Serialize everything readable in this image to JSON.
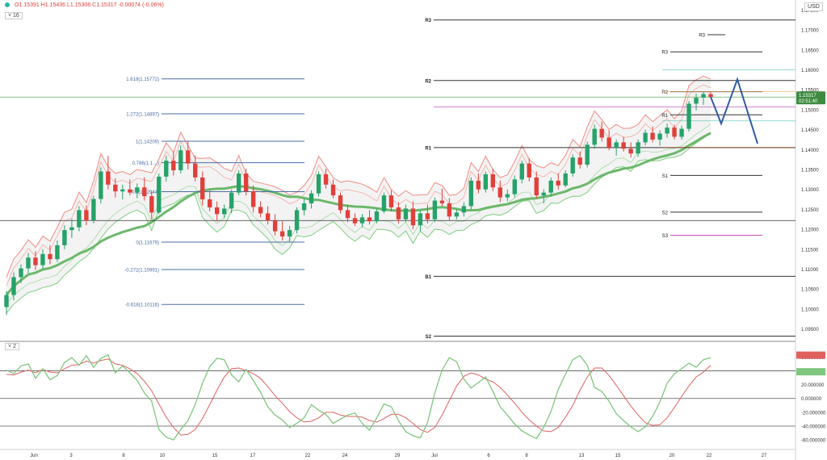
{
  "header": {
    "ohlc": "O1.15391  H1.15436  L1.15308  C1.15317  -0.00074 (-0.06%)",
    "indicator_collapse": "˅ 16",
    "osc_collapse": "˅ 2",
    "currency": "USD"
  },
  "colors": {
    "up": "#26a269",
    "down": "#e0403a",
    "envelope_red": "#f28b82",
    "envelope_green": "#7fcf7f",
    "ma": "#6cb86c",
    "ma_red": "#e57373",
    "fib": "#4a6fa5",
    "pivot": "#333333",
    "projection": "#2f5d9e",
    "stoch_k": "#7fc77f",
    "stoch_d": "#e06060",
    "price_tag": "#3d8b40"
  },
  "chart_data": {
    "type": "candlestick",
    "price_axis": {
      "ylim": [
        1.0925,
        1.1775
      ],
      "ticks": [
        "1.17500",
        "1.17000",
        "1.16500",
        "1.16000",
        "1.15500",
        "1.15000",
        "1.14500",
        "1.14000",
        "1.13500",
        "1.13000",
        "1.12500",
        "1.12000",
        "1.11500",
        "1.11000",
        "1.10500",
        "1.10000",
        "1.09500"
      ]
    },
    "x_axis": {
      "labels": [
        "Jun",
        "3",
        "8",
        "10",
        "15",
        "17",
        "22",
        "24",
        "29",
        "Jul",
        "6",
        "8",
        "13",
        "15",
        "20",
        "22",
        "27"
      ]
    },
    "fib_levels": [
      {
        "label": "1.618(1.15772)",
        "value": 1.15772
      },
      {
        "label": "1.272(1.14897)",
        "value": 1.14897
      },
      {
        "label": "1(1.14209)",
        "value": 1.14209
      },
      {
        "label": "0.786(1.1…)",
        "value": 1.1367
      },
      {
        "label": "0.5(1.12944)",
        "value": 1.12944
      },
      {
        "label": "0(1.11679)",
        "value": 1.11679
      },
      {
        "label": "-0.272(1.10991)",
        "value": 1.10991
      },
      {
        "label": "-0.618(1.10116)",
        "value": 1.10116
      }
    ],
    "monthly_pivots": [
      {
        "label": "R3",
        "value": 1.1725
      },
      {
        "label": "R2",
        "value": 1.1573
      },
      {
        "label": "R1",
        "value": 1.1405
      },
      {
        "label": "B1",
        "value": 1.1082
      },
      {
        "label": "S2",
        "value": 1.0932
      }
    ],
    "weekly_pivots": [
      {
        "label": "R3",
        "value": 1.1688
      },
      {
        "label": "R3",
        "value": 1.1645
      },
      {
        "label": "R2",
        "value": 1.1545
      },
      {
        "label": "R1",
        "value": 1.1487
      },
      {
        "label": "S1",
        "value": 1.1335
      },
      {
        "label": "S2",
        "value": 1.1243
      },
      {
        "label": "S3",
        "value": 1.1185
      }
    ],
    "candles": [
      {
        "o": 1.1005,
        "h": 1.1045,
        "l": 1.0985,
        "c": 1.1035
      },
      {
        "o": 1.1035,
        "h": 1.1092,
        "l": 1.1022,
        "c": 1.108
      },
      {
        "o": 1.108,
        "h": 1.1112,
        "l": 1.1065,
        "c": 1.1102
      },
      {
        "o": 1.1102,
        "h": 1.1141,
        "l": 1.109,
        "c": 1.1129
      },
      {
        "o": 1.1129,
        "h": 1.1145,
        "l": 1.1098,
        "c": 1.111
      },
      {
        "o": 1.111,
        "h": 1.115,
        "l": 1.11,
        "c": 1.1138
      },
      {
        "o": 1.1138,
        "h": 1.116,
        "l": 1.1112,
        "c": 1.1125
      },
      {
        "o": 1.1125,
        "h": 1.1172,
        "l": 1.1118,
        "c": 1.116
      },
      {
        "o": 1.116,
        "h": 1.121,
        "l": 1.115,
        "c": 1.1198
      },
      {
        "o": 1.1198,
        "h": 1.1226,
        "l": 1.1178,
        "c": 1.1205
      },
      {
        "o": 1.1205,
        "h": 1.1258,
        "l": 1.1195,
        "c": 1.1248
      },
      {
        "o": 1.1248,
        "h": 1.126,
        "l": 1.121,
        "c": 1.1222
      },
      {
        "o": 1.1222,
        "h": 1.1284,
        "l": 1.1215,
        "c": 1.1276
      },
      {
        "o": 1.1276,
        "h": 1.1355,
        "l": 1.1265,
        "c": 1.1345
      },
      {
        "o": 1.1345,
        "h": 1.1384,
        "l": 1.13,
        "c": 1.1312
      },
      {
        "o": 1.1312,
        "h": 1.1328,
        "l": 1.128,
        "c": 1.1295
      },
      {
        "o": 1.1295,
        "h": 1.1312,
        "l": 1.1275,
        "c": 1.13
      },
      {
        "o": 1.13,
        "h": 1.1325,
        "l": 1.1285,
        "c": 1.1292
      },
      {
        "o": 1.1292,
        "h": 1.1315,
        "l": 1.1278,
        "c": 1.1305
      },
      {
        "o": 1.1305,
        "h": 1.133,
        "l": 1.1272,
        "c": 1.1283
      },
      {
        "o": 1.1283,
        "h": 1.1295,
        "l": 1.1225,
        "c": 1.1242
      },
      {
        "o": 1.1242,
        "h": 1.134,
        "l": 1.1238,
        "c": 1.1332
      },
      {
        "o": 1.1332,
        "h": 1.1385,
        "l": 1.132,
        "c": 1.1372
      },
      {
        "o": 1.1372,
        "h": 1.1395,
        "l": 1.1335,
        "c": 1.1348
      },
      {
        "o": 1.1348,
        "h": 1.141,
        "l": 1.134,
        "c": 1.1398
      },
      {
        "o": 1.1398,
        "h": 1.1422,
        "l": 1.135,
        "c": 1.1365
      },
      {
        "o": 1.1365,
        "h": 1.1385,
        "l": 1.132,
        "c": 1.133
      },
      {
        "o": 1.133,
        "h": 1.1345,
        "l": 1.126,
        "c": 1.1275
      },
      {
        "o": 1.1275,
        "h": 1.1298,
        "l": 1.1245,
        "c": 1.1255
      },
      {
        "o": 1.1255,
        "h": 1.127,
        "l": 1.122,
        "c": 1.1238
      },
      {
        "o": 1.1238,
        "h": 1.1262,
        "l": 1.1228,
        "c": 1.1252
      },
      {
        "o": 1.1252,
        "h": 1.13,
        "l": 1.124,
        "c": 1.1292
      },
      {
        "o": 1.1292,
        "h": 1.1348,
        "l": 1.1285,
        "c": 1.134
      },
      {
        "o": 1.134,
        "h": 1.1352,
        "l": 1.1285,
        "c": 1.1295
      },
      {
        "o": 1.1295,
        "h": 1.131,
        "l": 1.1242,
        "c": 1.1256
      },
      {
        "o": 1.1256,
        "h": 1.127,
        "l": 1.123,
        "c": 1.124
      },
      {
        "o": 1.124,
        "h": 1.1258,
        "l": 1.1212,
        "c": 1.1222
      },
      {
        "o": 1.1222,
        "h": 1.1238,
        "l": 1.1185,
        "c": 1.1195
      },
      {
        "o": 1.1195,
        "h": 1.122,
        "l": 1.1172,
        "c": 1.1182
      },
      {
        "o": 1.1182,
        "h": 1.1208,
        "l": 1.1168,
        "c": 1.1198
      },
      {
        "o": 1.1198,
        "h": 1.1255,
        "l": 1.119,
        "c": 1.1248
      },
      {
        "o": 1.1248,
        "h": 1.1278,
        "l": 1.1235,
        "c": 1.1265
      },
      {
        "o": 1.1265,
        "h": 1.1298,
        "l": 1.1252,
        "c": 1.129
      },
      {
        "o": 1.129,
        "h": 1.1345,
        "l": 1.1282,
        "c": 1.1338
      },
      {
        "o": 1.1338,
        "h": 1.1352,
        "l": 1.1302,
        "c": 1.1312
      },
      {
        "o": 1.1312,
        "h": 1.1325,
        "l": 1.1278,
        "c": 1.1285
      },
      {
        "o": 1.1285,
        "h": 1.1292,
        "l": 1.124,
        "c": 1.1248
      },
      {
        "o": 1.1248,
        "h": 1.1262,
        "l": 1.1218,
        "c": 1.1228
      },
      {
        "o": 1.1228,
        "h": 1.124,
        "l": 1.1208,
        "c": 1.1215
      },
      {
        "o": 1.1215,
        "h": 1.1238,
        "l": 1.1205,
        "c": 1.123
      },
      {
        "o": 1.123,
        "h": 1.1248,
        "l": 1.1212,
        "c": 1.122
      },
      {
        "o": 1.122,
        "h": 1.1252,
        "l": 1.1215,
        "c": 1.1245
      },
      {
        "o": 1.1245,
        "h": 1.1292,
        "l": 1.124,
        "c": 1.1285
      },
      {
        "o": 1.1285,
        "h": 1.1298,
        "l": 1.1245,
        "c": 1.1255
      },
      {
        "o": 1.1255,
        "h": 1.1268,
        "l": 1.1215,
        "c": 1.1225
      },
      {
        "o": 1.1225,
        "h": 1.1262,
        "l": 1.1218,
        "c": 1.1252
      },
      {
        "o": 1.1252,
        "h": 1.127,
        "l": 1.12,
        "c": 1.121
      },
      {
        "o": 1.121,
        "h": 1.1248,
        "l": 1.1195,
        "c": 1.124
      },
      {
        "o": 1.124,
        "h": 1.1262,
        "l": 1.1215,
        "c": 1.1225
      },
      {
        "o": 1.1225,
        "h": 1.128,
        "l": 1.1218,
        "c": 1.1272
      },
      {
        "o": 1.1272,
        "h": 1.1302,
        "l": 1.1258,
        "c": 1.1265
      },
      {
        "o": 1.1265,
        "h": 1.1278,
        "l": 1.1222,
        "c": 1.1232
      },
      {
        "o": 1.1232,
        "h": 1.125,
        "l": 1.1225,
        "c": 1.1242
      },
      {
        "o": 1.1242,
        "h": 1.1268,
        "l": 1.1232,
        "c": 1.1258
      },
      {
        "o": 1.1258,
        "h": 1.133,
        "l": 1.125,
        "c": 1.1322
      },
      {
        "o": 1.1322,
        "h": 1.134,
        "l": 1.129,
        "c": 1.13
      },
      {
        "o": 1.13,
        "h": 1.1345,
        "l": 1.1292,
        "c": 1.1338
      },
      {
        "o": 1.1338,
        "h": 1.1352,
        "l": 1.1295,
        "c": 1.1305
      },
      {
        "o": 1.1305,
        "h": 1.1322,
        "l": 1.1268,
        "c": 1.128
      },
      {
        "o": 1.128,
        "h": 1.13,
        "l": 1.127,
        "c": 1.1288
      },
      {
        "o": 1.1288,
        "h": 1.1335,
        "l": 1.128,
        "c": 1.1325
      },
      {
        "o": 1.1325,
        "h": 1.1372,
        "l": 1.1315,
        "c": 1.1365
      },
      {
        "o": 1.1365,
        "h": 1.1378,
        "l": 1.132,
        "c": 1.133
      },
      {
        "o": 1.133,
        "h": 1.1345,
        "l": 1.1278,
        "c": 1.1285
      },
      {
        "o": 1.1285,
        "h": 1.13,
        "l": 1.1265,
        "c": 1.1292
      },
      {
        "o": 1.1292,
        "h": 1.133,
        "l": 1.1282,
        "c": 1.1322
      },
      {
        "o": 1.1322,
        "h": 1.134,
        "l": 1.13,
        "c": 1.131
      },
      {
        "o": 1.131,
        "h": 1.1348,
        "l": 1.1305,
        "c": 1.134
      },
      {
        "o": 1.134,
        "h": 1.1388,
        "l": 1.1332,
        "c": 1.138
      },
      {
        "o": 1.138,
        "h": 1.1395,
        "l": 1.1352,
        "c": 1.1362
      },
      {
        "o": 1.1362,
        "h": 1.142,
        "l": 1.1355,
        "c": 1.1412
      },
      {
        "o": 1.1412,
        "h": 1.1462,
        "l": 1.1402,
        "c": 1.1452
      },
      {
        "o": 1.1452,
        "h": 1.147,
        "l": 1.142,
        "c": 1.143
      },
      {
        "o": 1.143,
        "h": 1.1448,
        "l": 1.1398,
        "c": 1.1405
      },
      {
        "o": 1.1405,
        "h": 1.1425,
        "l": 1.1385,
        "c": 1.1418
      },
      {
        "o": 1.1418,
        "h": 1.1432,
        "l": 1.1395,
        "c": 1.1402
      },
      {
        "o": 1.1402,
        "h": 1.1418,
        "l": 1.138,
        "c": 1.139
      },
      {
        "o": 1.139,
        "h": 1.1425,
        "l": 1.1382,
        "c": 1.1418
      },
      {
        "o": 1.1418,
        "h": 1.145,
        "l": 1.141,
        "c": 1.1442
      },
      {
        "o": 1.1442,
        "h": 1.1458,
        "l": 1.1418,
        "c": 1.1425
      },
      {
        "o": 1.1425,
        "h": 1.1448,
        "l": 1.141,
        "c": 1.144
      },
      {
        "o": 1.144,
        "h": 1.1465,
        "l": 1.143,
        "c": 1.1455
      },
      {
        "o": 1.1455,
        "h": 1.1462,
        "l": 1.1425,
        "c": 1.1432
      },
      {
        "o": 1.1432,
        "h": 1.146,
        "l": 1.1425,
        "c": 1.1452
      },
      {
        "o": 1.1452,
        "h": 1.1522,
        "l": 1.1445,
        "c": 1.1515
      },
      {
        "o": 1.1515,
        "h": 1.154,
        "l": 1.1498,
        "c": 1.153
      },
      {
        "o": 1.153,
        "h": 1.1545,
        "l": 1.1512,
        "c": 1.1539
      },
      {
        "o": 1.1539,
        "h": 1.1544,
        "l": 1.1531,
        "c": 1.1532
      }
    ],
    "projection_path": [
      1.1532,
      1.1465,
      1.1576,
      1.1415
    ],
    "current_price_label": "1.15317",
    "countdown_label": "02:51:40",
    "oscillator": {
      "ylim": [
        -68,
        72
      ],
      "ticks": [
        "60.000000",
        "40.000000",
        "20.000000",
        "0.000000",
        "-20.000000",
        "-40.000000",
        "-60.000000"
      ],
      "levels": [
        40,
        0,
        -40
      ],
      "k": [
        41,
        36,
        47,
        50,
        29,
        43,
        27,
        33,
        52,
        59,
        48,
        62,
        45,
        58,
        63,
        37,
        47,
        37,
        26,
        8,
        -4,
        -45,
        -56,
        -60,
        -45,
        -32,
        -9,
        22,
        46,
        58,
        56,
        34,
        24,
        42,
        26,
        9,
        -12,
        -24,
        -31,
        -42,
        -36,
        -28,
        -9,
        -17,
        -23,
        -36,
        -30,
        -24,
        -21,
        -36,
        -46,
        -28,
        -8,
        -12,
        -32,
        -48,
        -54,
        -57,
        -35,
        8,
        41,
        59,
        53,
        28,
        15,
        23,
        31,
        10,
        -12,
        -24,
        -37,
        -47,
        -53,
        -58,
        -42,
        -19,
        13,
        35,
        56,
        62,
        48,
        16,
        10,
        -4,
        -22,
        -32,
        -41,
        -48,
        -41,
        -26,
        -5,
        22,
        36,
        43,
        51,
        45,
        56,
        59
      ],
      "d": [
        35,
        34,
        38,
        41,
        37,
        42,
        38,
        37,
        43,
        48,
        49,
        54,
        51,
        55,
        57,
        50,
        48,
        43,
        36,
        25,
        11,
        -8,
        -27,
        -42,
        -53,
        -52,
        -45,
        -29,
        -9,
        12,
        31,
        43,
        44,
        40,
        36,
        29,
        17,
        4,
        -7,
        -19,
        -28,
        -34,
        -33,
        -28,
        -20,
        -20,
        -24,
        -26,
        -26,
        -27,
        -32,
        -34,
        -29,
        -23,
        -23,
        -28,
        -36,
        -45,
        -49,
        -42,
        -24,
        -3,
        18,
        32,
        37,
        34,
        28,
        24,
        16,
        5,
        -7,
        -20,
        -31,
        -40,
        -47,
        -48,
        -42,
        -27,
        -10,
        12,
        31,
        44,
        44,
        33,
        19,
        4,
        -11,
        -24,
        -35,
        -39,
        -38,
        -28,
        -13,
        3,
        18,
        31,
        38,
        48
      ]
    }
  }
}
